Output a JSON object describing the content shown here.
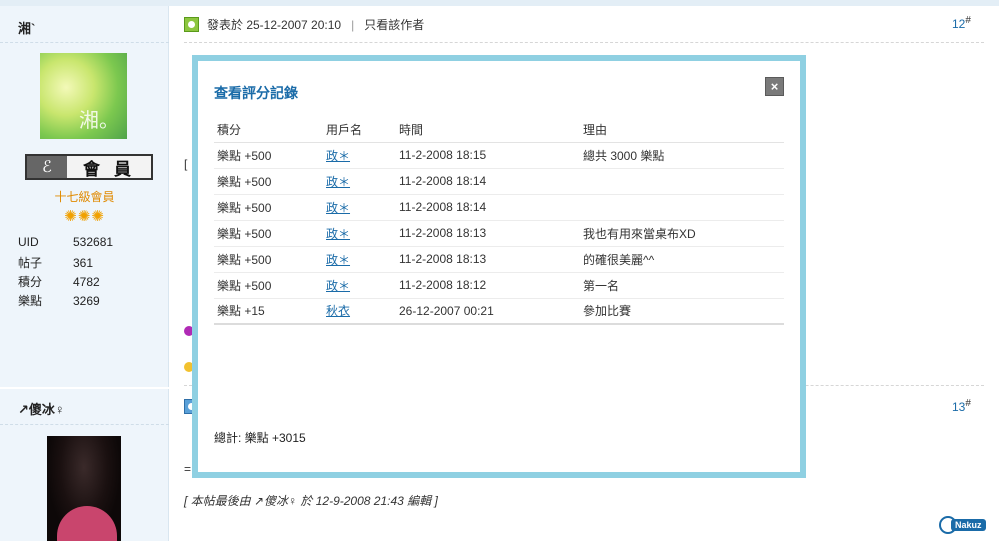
{
  "post1": {
    "author": "湘`",
    "avatar_text": "湘。",
    "member_badge": "會員",
    "level": "十七級會員",
    "stars": "✺✺✺",
    "stats": [
      {
        "label": "UID",
        "value": "532681"
      },
      {
        "label": "帖子",
        "value": "361"
      },
      {
        "label": "積分",
        "value": "4782"
      },
      {
        "label": "樂點",
        "value": "3269"
      }
    ],
    "posted": "發表於 25-12-2007 20:10",
    "only_author": "只看該作者",
    "floor": "12",
    "floor_mark": "#",
    "fragment": "["
  },
  "post2": {
    "author": "↗傻冰♀",
    "floor": "13",
    "floor_mark": "#",
    "fragment": "="
  },
  "edit_note": "[ 本帖最後由 ↗傻冰♀ 於 12-9-2008 21:43 編輯 ]",
  "modal": {
    "title": "查看評分記錄",
    "close_label": "×",
    "columns": [
      "積分",
      "用戶名",
      "時間",
      "理由"
    ],
    "rows": [
      {
        "points": "樂點 +500",
        "user": "政＊",
        "time": "11-2-2008 18:15",
        "reason": "總共 3000 樂點"
      },
      {
        "points": "樂點 +500",
        "user": "政＊",
        "time": "11-2-2008 18:14",
        "reason": ""
      },
      {
        "points": "樂點 +500",
        "user": "政＊",
        "time": "11-2-2008 18:14",
        "reason": ""
      },
      {
        "points": "樂點 +500",
        "user": "政＊",
        "time": "11-2-2008 18:13",
        "reason": "我也有用來當桌布XD"
      },
      {
        "points": "樂點 +500",
        "user": "政＊",
        "time": "11-2-2008 18:13",
        "reason": "的確很美麗^^"
      },
      {
        "points": "樂點 +500",
        "user": "政＊",
        "time": "11-2-2008 18:12",
        "reason": "第一名"
      },
      {
        "points": "樂點 +15",
        "user": "秋衣",
        "time": "26-12-2007 00:21",
        "reason": "參加比賽"
      }
    ],
    "total": "總計: 樂點 +3015"
  },
  "brand_logo": "Nakuz",
  "colors": {
    "accent": "#1a6ba8",
    "modal_border": "#8fd0e2",
    "sidebar_bg": "#eef5fb"
  }
}
